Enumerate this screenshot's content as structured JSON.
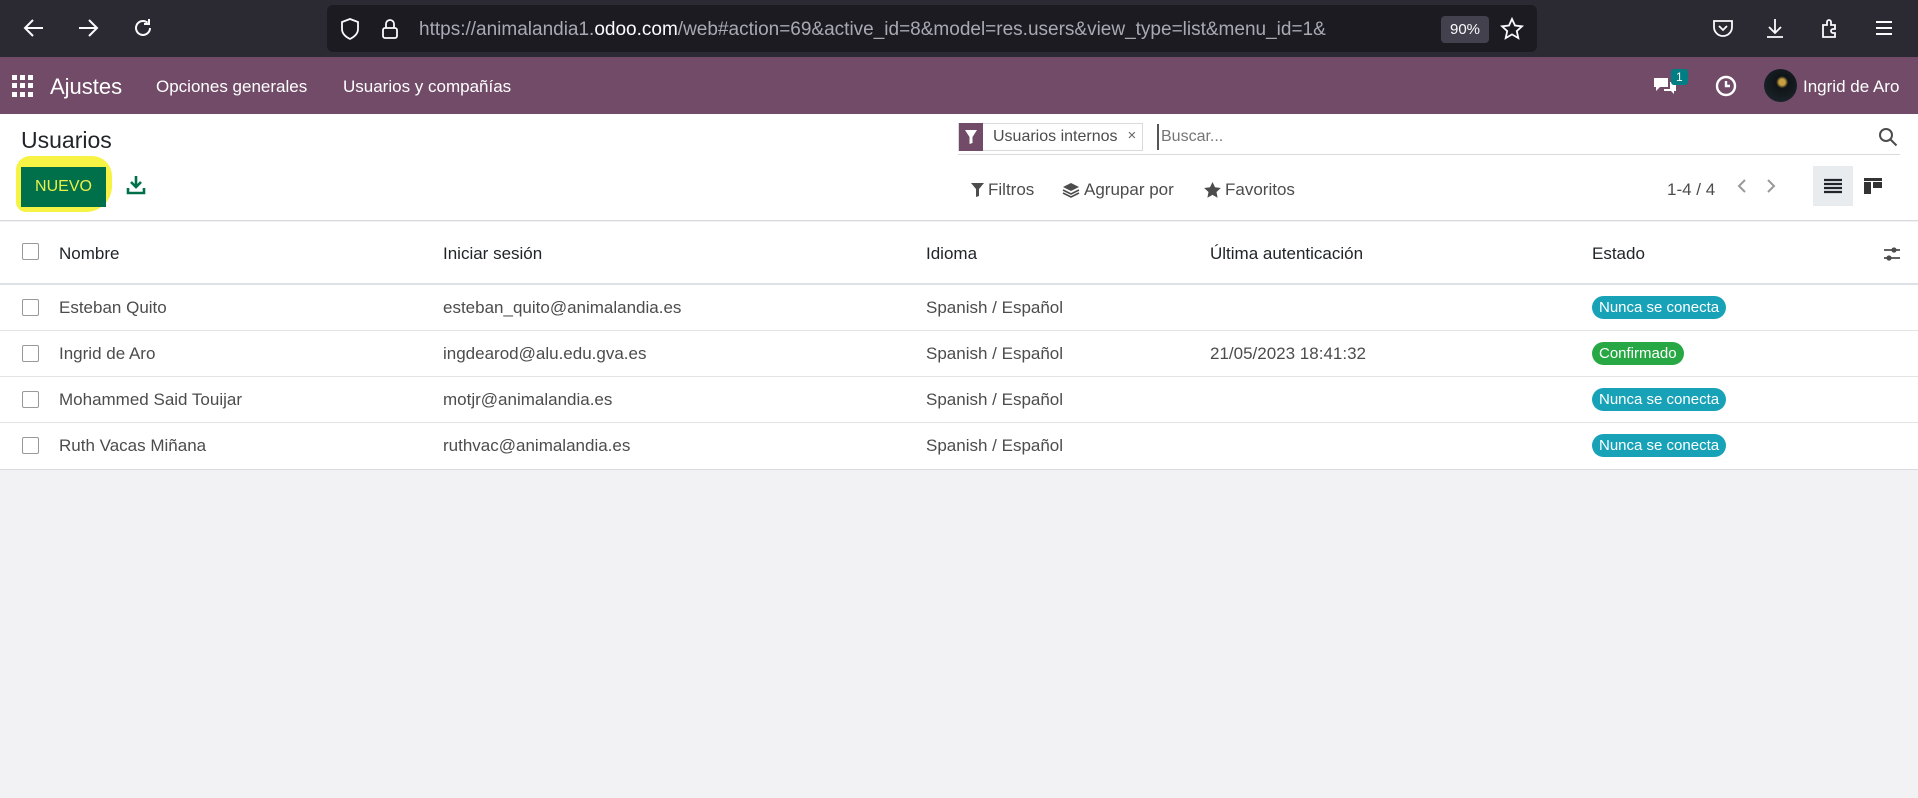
{
  "browser": {
    "url_prefix": "https://animalandia1.",
    "url_domain": "odoo.com",
    "url_suffix": "/web#action=69&active_id=8&model=res.users&view_type=list&menu_id=1&",
    "zoom": "90%"
  },
  "navbar": {
    "brand": "Ajustes",
    "items": [
      "Opciones generales",
      "Usuarios y compañías"
    ],
    "message_count": "1",
    "user_name": "Ingrid de Aro",
    "color": "#714b67"
  },
  "control_panel": {
    "title": "Usuarios",
    "new_button": "NUEVO",
    "facet_label": "Usuarios internos",
    "facet_remove": "×",
    "search_placeholder": "Buscar...",
    "filters_label": "Filtros",
    "group_by_label": "Agrupar por",
    "favorites_label": "Favoritos",
    "pager": "1-4 / 4"
  },
  "list": {
    "columns": {
      "name": "Nombre",
      "login": "Iniciar sesión",
      "language": "Idioma",
      "last_auth": "Última autenticación",
      "state": "Estado"
    },
    "rows": [
      {
        "name": "Esteban Quito",
        "login": "esteban_quito@animalandia.es",
        "language": "Spanish / Español",
        "last_auth": "",
        "state": "Nunca se conecta",
        "state_type": "info"
      },
      {
        "name": "Ingrid de Aro",
        "login": "ingdearod@alu.edu.gva.es",
        "language": "Spanish / Español",
        "last_auth": "21/05/2023 18:41:32",
        "state": "Confirmado",
        "state_type": "success"
      },
      {
        "name": "Mohammed Said Touijar",
        "login": "motjr@animalandia.es",
        "language": "Spanish / Español",
        "last_auth": "",
        "state": "Nunca se conecta",
        "state_type": "info"
      },
      {
        "name": "Ruth Vacas Miñana",
        "login": "ruthvac@animalandia.es",
        "language": "Spanish / Español",
        "last_auth": "",
        "state": "Nunca se conecta",
        "state_type": "info"
      }
    ]
  }
}
